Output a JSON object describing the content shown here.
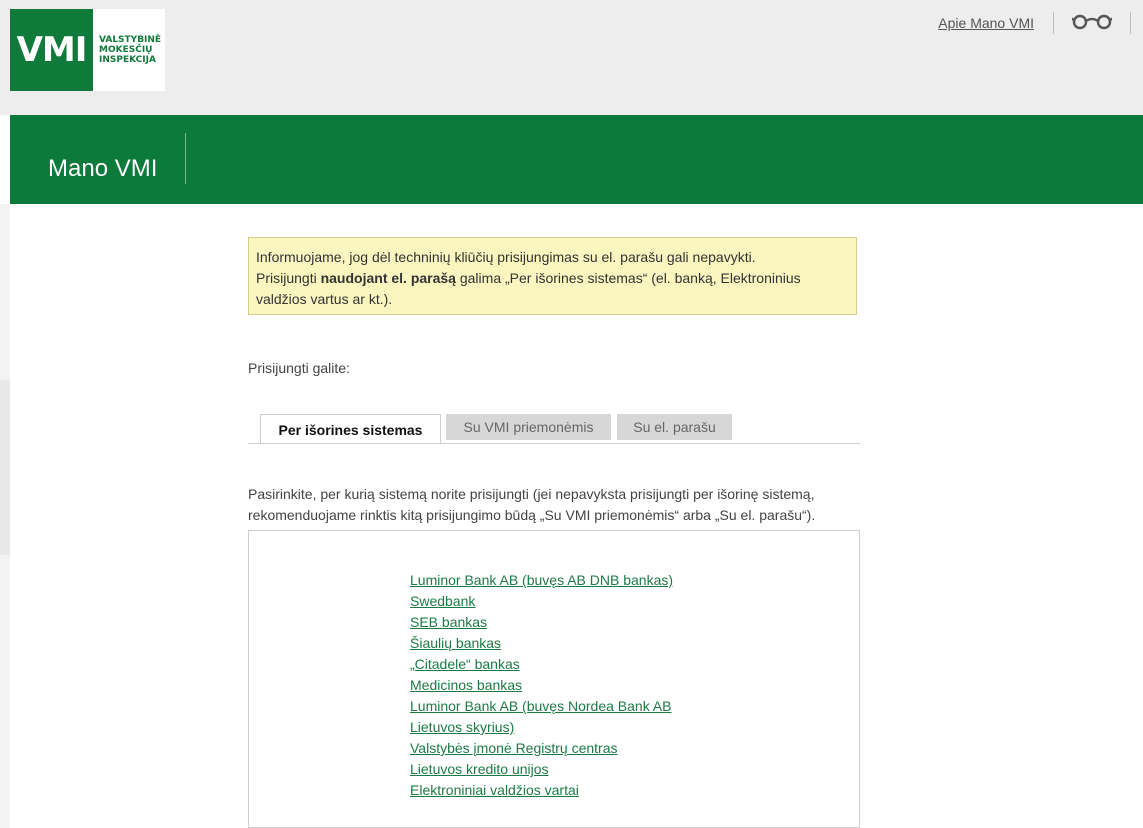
{
  "header": {
    "logo_abbr": "VMI",
    "logo_lines": [
      "VALSTYBINĖ",
      "MOKESČIŲ",
      "INSPEKCIJA"
    ],
    "about_link": "Apie Mano VMI",
    "accessibility_icon": "glasses-icon"
  },
  "banner": {
    "title": "Mano VMI"
  },
  "notice": {
    "line1": "Informuojame, jog dėl techninių kliūčių prisijungimas su el. parašu gali nepavykti.",
    "line2_prefix": "Prisijungti ",
    "line2_bold": "naudojant el. parašą",
    "line2_suffix": " galima „Per išorines sistemas“ (el. banką, Elektroninius valdžios vartus ar kt.)."
  },
  "login": {
    "intro": "Prisijungti galite:",
    "tabs": [
      {
        "label": "Per išorines sistemas",
        "active": true
      },
      {
        "label": "Su VMI priemonėmis",
        "active": false
      },
      {
        "label": "Su el. parašu",
        "active": false
      }
    ],
    "description": "Pasirinkite, per kurią sistemą norite prisijungti (jei nepavyksta prisijungti per išorinę sistemą, rekomenduojame rinktis kitą prisijungimo būdą „Su VMI priemonėmis“ arba „Su el. parašu“).",
    "providers": [
      "Luminor Bank AB (buvęs AB DNB bankas)",
      "Swedbank ",
      "SEB bankas ",
      "Šiaulių bankas ",
      "„Citadele“ bankas ",
      "Medicinos bankas ",
      "Luminor Bank AB (buvęs Nordea Bank AB",
      "Lietuvos skyrius) ",
      "Valstybės įmonė Registrų centras ",
      "Lietuvos kredito unijos ",
      "Elektroniniai valdžios vartai "
    ]
  },
  "colors": {
    "brand_green": "#0b7a3a",
    "link_green": "#1d7a45",
    "notice_bg": "#fbf6c0"
  }
}
